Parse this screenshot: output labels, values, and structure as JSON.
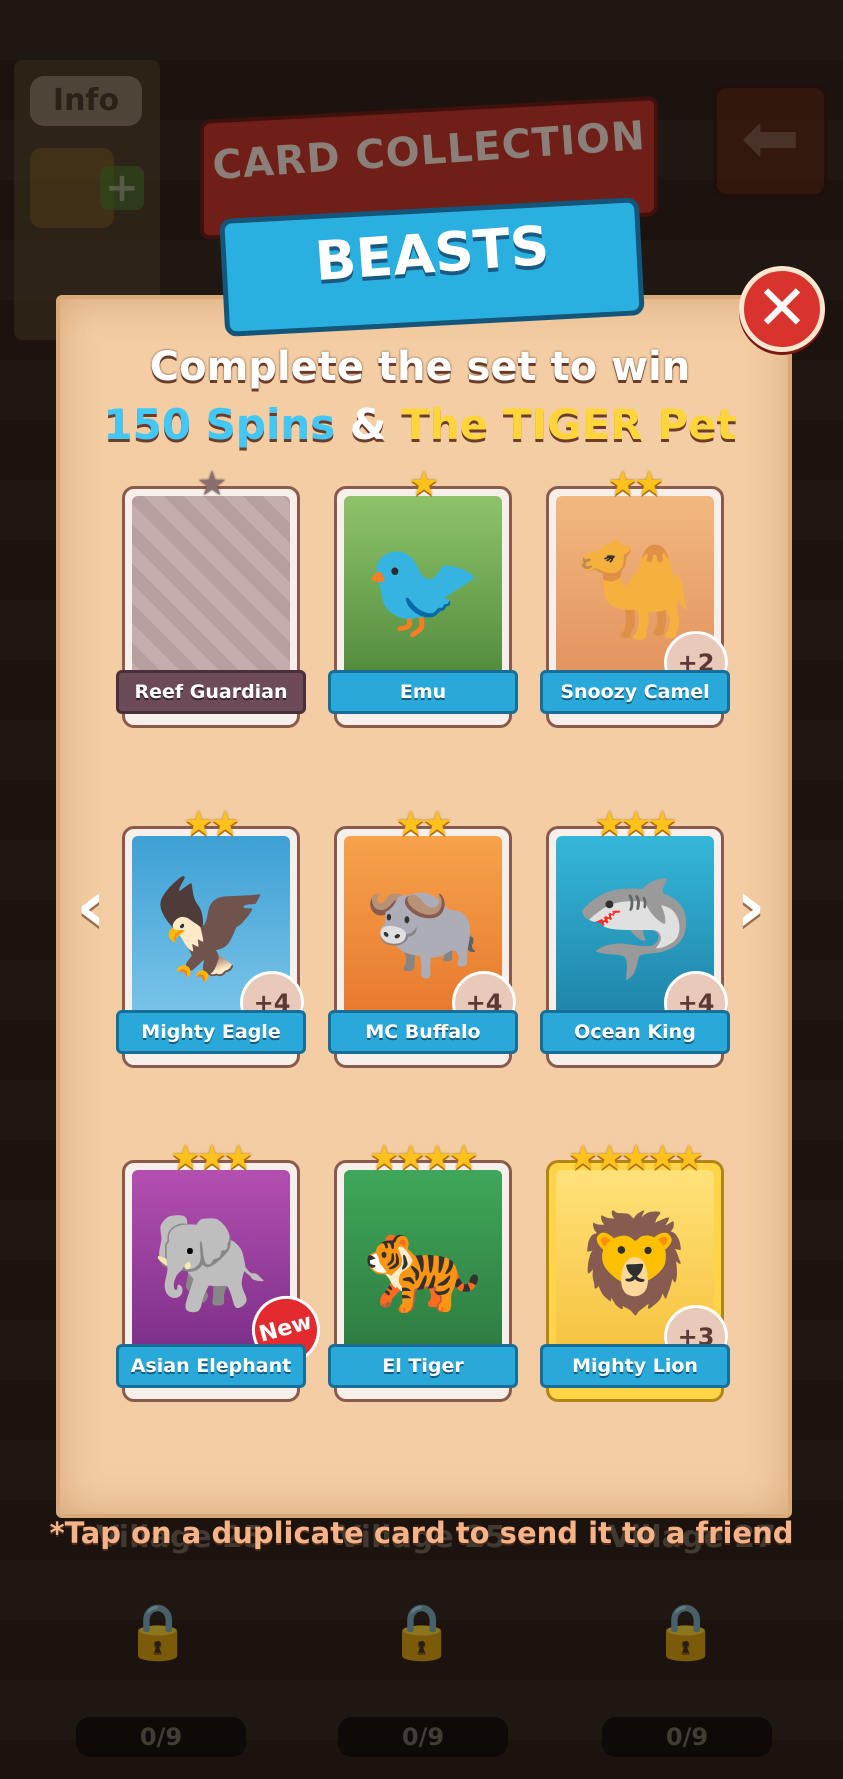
{
  "background": {
    "info_label": "Info",
    "villages": [
      {
        "label": "Village 25",
        "progress": "0/9"
      },
      {
        "label": "Village 25",
        "progress": "0/9"
      },
      {
        "label": "Village 27",
        "progress": "0/9"
      }
    ]
  },
  "header": {
    "collection_title": "CARD COLLECTION",
    "set_name": "BEASTS"
  },
  "reward": {
    "line1": "Complete the set to win",
    "spins": "150 Spins",
    "amp": "&",
    "pet": "The TIGER Pet"
  },
  "cards": [
    {
      "name": "Reef Guardian",
      "stars": "★",
      "locked": true,
      "badge": ""
    },
    {
      "name": "Emu",
      "stars": "★",
      "locked": false,
      "badge": ""
    },
    {
      "name": "Snoozy Camel",
      "stars": "★★",
      "locked": false,
      "badge": "+2"
    },
    {
      "name": "Mighty Eagle",
      "stars": "★★",
      "locked": false,
      "badge": "+4"
    },
    {
      "name": "MC Buffalo",
      "stars": "★★",
      "locked": false,
      "badge": "+4"
    },
    {
      "name": "Ocean King",
      "stars": "★★★",
      "locked": false,
      "badge": "+4"
    },
    {
      "name": "Asian Elephant",
      "stars": "★★★",
      "locked": false,
      "badge": "New"
    },
    {
      "name": "El Tiger",
      "stars": "★★★★",
      "locked": false,
      "badge": ""
    },
    {
      "name": "Mighty Lion",
      "stars": "★★★★★",
      "locked": false,
      "badge": "+3"
    }
  ],
  "footer_note": "*Tap on a duplicate card to send it to a friend",
  "colors": {
    "accent_blue": "#28a9da",
    "gold": "#ffc21c",
    "close_red": "#d9332e"
  }
}
